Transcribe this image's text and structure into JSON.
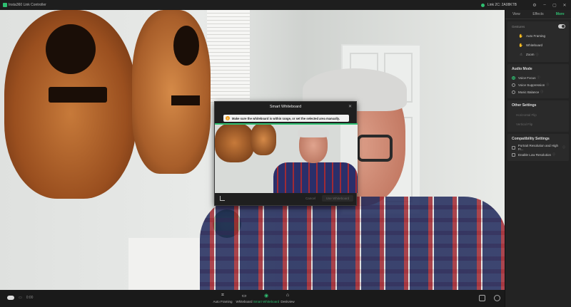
{
  "app": {
    "title": "Insta360 Link Controller",
    "device_name": "Link 2C: 2A08KTB",
    "accent_color": "#2fbf71"
  },
  "titlebar": {
    "icons": [
      "camera-status-dot",
      "settings-icon",
      "minimize-icon",
      "maximize-icon",
      "close-icon"
    ]
  },
  "panel": {
    "tabs": [
      {
        "label": "View",
        "active": false
      },
      {
        "label": "Effects",
        "active": false
      },
      {
        "label": "More",
        "active": true
      }
    ],
    "gestures": {
      "label": "Gestures",
      "enabled": true,
      "items": [
        {
          "label": "Auto Framing",
          "icon": "palm-icon"
        },
        {
          "label": "Whiteboard",
          "icon": "hand-icon"
        },
        {
          "label": "Zoom",
          "icon": "pinch-icon"
        }
      ]
    },
    "audio": {
      "title": "Audio Mode",
      "options": [
        {
          "label": "Voice Focus",
          "selected": true
        },
        {
          "label": "Voice Suppression",
          "selected": false
        },
        {
          "label": "Music Balance",
          "selected": false
        }
      ]
    },
    "other": {
      "title": "Other Settings",
      "items": [
        "Horizontal Flip",
        "Vertical Flip"
      ]
    },
    "compat": {
      "title": "Compatibility Settings",
      "items": [
        {
          "label": "Portrait Resolution and High Fr...",
          "checked": false
        },
        {
          "label": "Enable Low Resolution",
          "checked": false
        }
      ]
    }
  },
  "modal": {
    "title": "Smart Whiteboard",
    "close_glyph": "✕",
    "warning": "Make sure the whiteboard is within range, or set the selected area manually.",
    "cancel_label": "Cancel",
    "apply_label": "Use Whiteboard"
  },
  "bottombar": {
    "left_value": "0:00",
    "tools": [
      {
        "label": "Auto Framing",
        "active": false,
        "glyph": "⌗"
      },
      {
        "label": "Whiteboard",
        "active": false,
        "glyph": "▭"
      },
      {
        "label": "Smart Whiteboard",
        "active": true,
        "glyph": "◉"
      },
      {
        "label": "Deskview",
        "active": false,
        "glyph": "⌂"
      }
    ]
  }
}
